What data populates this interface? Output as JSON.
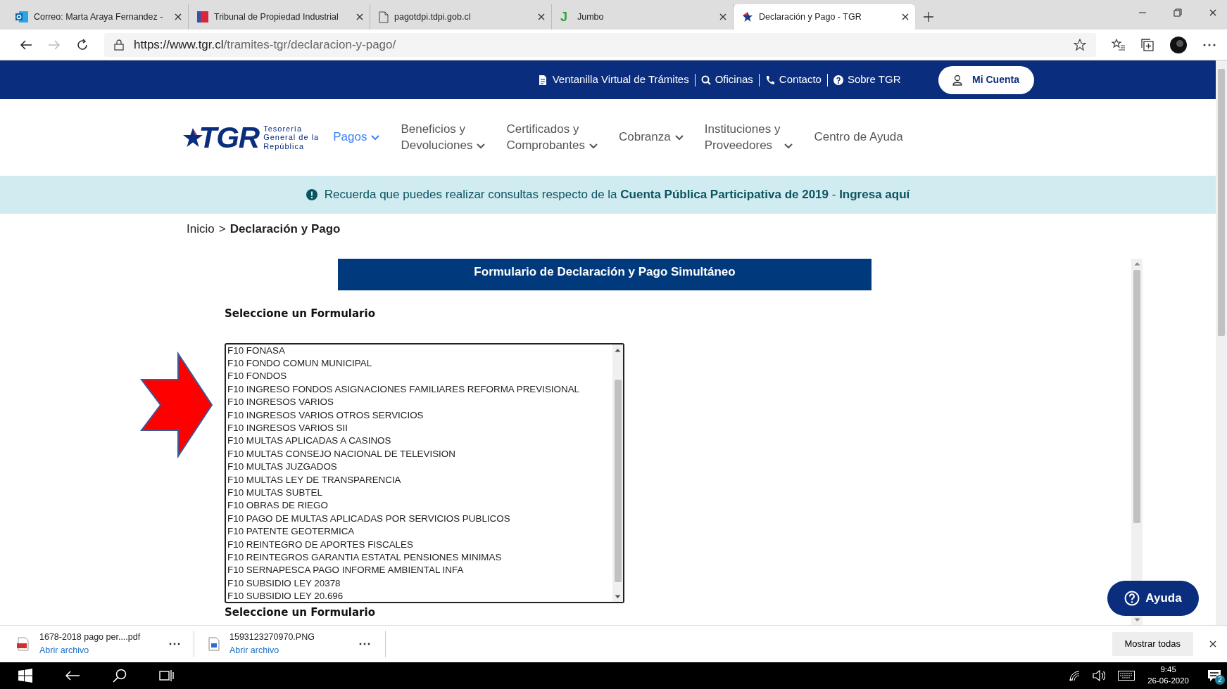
{
  "browser": {
    "tabs": [
      {
        "title": "Correo: Marta Araya Fernandez -",
        "selected": false
      },
      {
        "title": "Tribunal de Propiedad Industrial",
        "selected": false
      },
      {
        "title": "pagotdpi.tdpi.gob.cl",
        "selected": false
      },
      {
        "title": "Jumbo",
        "favicon_text": "J",
        "selected": false
      },
      {
        "title": "Declaración y Pago - TGR",
        "selected": true
      }
    ],
    "url_host": "https://www.tgr.cl",
    "url_path": "/tramites-tgr/declaracion-y-pago/"
  },
  "top_bar": {
    "links": [
      {
        "label": "Ventanilla Virtual de Trámites"
      },
      {
        "label": "Oficinas"
      },
      {
        "label": "Contacto"
      },
      {
        "label": "Sobre TGR"
      }
    ],
    "account_button": "Mi Cuenta"
  },
  "logo": {
    "mark": "TGR",
    "subtitle_lines": [
      "Tesorería",
      "General de la",
      "República"
    ]
  },
  "nav": [
    {
      "label": "Pagos",
      "dropdown": true,
      "selected": true
    },
    {
      "label": "Beneficios y\nDevoluciones",
      "dropdown": true,
      "selected": false
    },
    {
      "label": "Certificados y\nComprobantes",
      "dropdown": true,
      "selected": false
    },
    {
      "label": "Cobranza",
      "dropdown": true,
      "selected": false
    },
    {
      "label": "Instituciones y\nProveedores",
      "dropdown": true,
      "selected": false
    },
    {
      "label": "Centro de Ayuda",
      "dropdown": false,
      "selected": false
    }
  ],
  "alert": "Recuerda que puedes realizar consultas respecto de la **Cuenta Pública Participativa de 2019** - **Ingresa aquí**",
  "breadcrumb": {
    "home": "Inicio",
    "separator": ">",
    "current": "Declaración y Pago"
  },
  "form": {
    "title": "Formulario de Declaración y Pago Simultáneo",
    "select_label": "Seleccione un Formulario",
    "options": [
      "F10 FONASA",
      "F10 FONDO COMUN MUNICIPAL",
      "F10 FONDOS",
      "F10 INGRESO FONDOS ASIGNACIONES FAMILIARES REFORMA PREVISIONAL",
      "F10 INGRESOS VARIOS",
      "F10 INGRESOS VARIOS OTROS SERVICIOS",
      "F10 INGRESOS VARIOS SII",
      "F10 MULTAS APLICADAS A CASINOS",
      "F10 MULTAS CONSEJO NACIONAL DE TELEVISION",
      "F10 MULTAS JUZGADOS",
      "F10 MULTAS LEY DE TRANSPARENCIA",
      "F10 MULTAS SUBTEL",
      "F10 OBRAS DE RIEGO",
      "F10 PAGO DE MULTAS APLICADAS POR SERVICIOS PUBLICOS",
      "F10 PATENTE GEOTERMICA",
      "F10 REINTEGRO DE APORTES FISCALES",
      "F10 REINTEGROS GARANTIA ESTATAL PENSIONES MINIMAS",
      "F10 SERNAPESCA PAGO INFORME AMBIENTAL INFA",
      "F10 SUBSIDIO LEY 20378",
      "F10 SUBSIDIO LEY 20.696"
    ],
    "second_label": "Seleccione un Formulario"
  },
  "help_button": "Ayuda",
  "downloads": {
    "items": [
      {
        "name": "1678-2018 pago per....pdf",
        "action": "Abrir archivo"
      },
      {
        "name": "1593123270970.PNG",
        "action": "Abrir archivo"
      }
    ],
    "show_all": "Mostrar todas"
  },
  "taskbar": {
    "time": "9:45",
    "date": "26-06-2020",
    "notifications": "2"
  }
}
